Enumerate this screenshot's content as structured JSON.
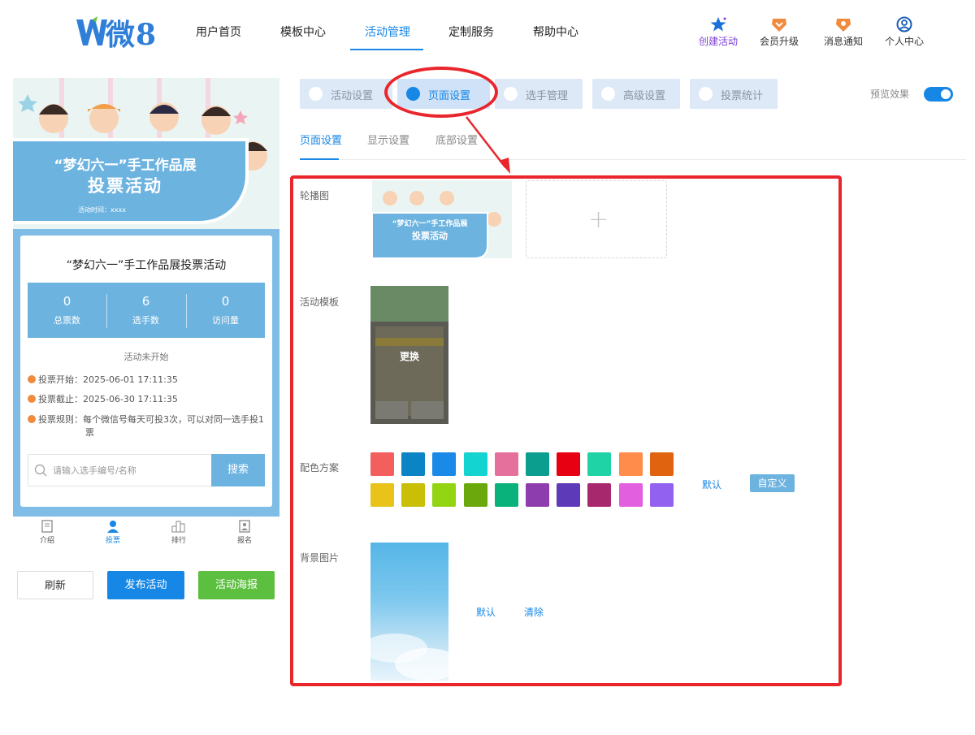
{
  "app": {
    "brand": "微8",
    "nav": [
      "用户首页",
      "模板中心",
      "活动管理",
      "定制服务",
      "帮助中心"
    ],
    "header_actions": [
      {
        "label": "创建活动",
        "icon": "star-icon",
        "color": "#7b3fd3"
      },
      {
        "label": "会员升级",
        "icon": "vip-badge-icon",
        "color": "#f08a3c"
      },
      {
        "label": "消息通知",
        "icon": "bell-badge-icon",
        "color": "#f08a3c"
      },
      {
        "label": "个人中心",
        "icon": "user-circle-icon",
        "color": "#1787e6"
      }
    ]
  },
  "preview": {
    "banner_title_line1": "“梦幻六一”手工作品展",
    "banner_title_line2": "投票活动",
    "banner_time": "活动时间：xxxx",
    "card_title": "“梦幻六一”手工作品展投票活动",
    "stats": [
      {
        "value": "0",
        "label": "总票数"
      },
      {
        "value": "6",
        "label": "选手数"
      },
      {
        "value": "0",
        "label": "访问量"
      }
    ],
    "status": "活动未开始",
    "info": [
      "投票开始：2025-06-01 17:11:35",
      "投票截止：2025-06-30 17:11:35",
      "投票规则：每个微信号每天可投3次，可以对同一选手投1票"
    ],
    "search_placeholder": "请输入选手编号/名称",
    "search_button": "搜索",
    "tabbar": [
      "介绍",
      "投票",
      "排行",
      "报名"
    ],
    "buttons": {
      "refresh": "刷新",
      "publish": "发布活动",
      "poster": "活动海报"
    }
  },
  "settings": {
    "top_tabs": [
      "活动设置",
      "页面设置",
      "选手管理",
      "高级设置",
      "投票统计"
    ],
    "preview_toggle_label": "预览效果",
    "sub_tabs": [
      "页面设置",
      "显示设置",
      "底部设置"
    ],
    "carousel_label": "轮播图",
    "carousel_thumb_title1": "“梦幻六一”手工作品展",
    "carousel_thumb_title2": "投票活动",
    "template_label": "活动模板",
    "template_change": "更换",
    "color_label": "配色方案",
    "color_default": "默认",
    "color_custom": "自定义",
    "colors": [
      "#f25f5c",
      "#0b84c6",
      "#1a89e8",
      "#13d4d0",
      "#e5709b",
      "#0b9e8f",
      "#e60012",
      "#1fd3a6",
      "#ff8c4a",
      "#e0640f",
      "#e9c21a",
      "#c9bf07",
      "#93d413",
      "#6aa80c",
      "#08b27a",
      "#8e3dae",
      "#5d3bb8",
      "#a8286e",
      "#e25fe0",
      "#9261ef"
    ],
    "bg_label": "背景图片",
    "bg_default": "默认",
    "bg_clear": "清除"
  }
}
